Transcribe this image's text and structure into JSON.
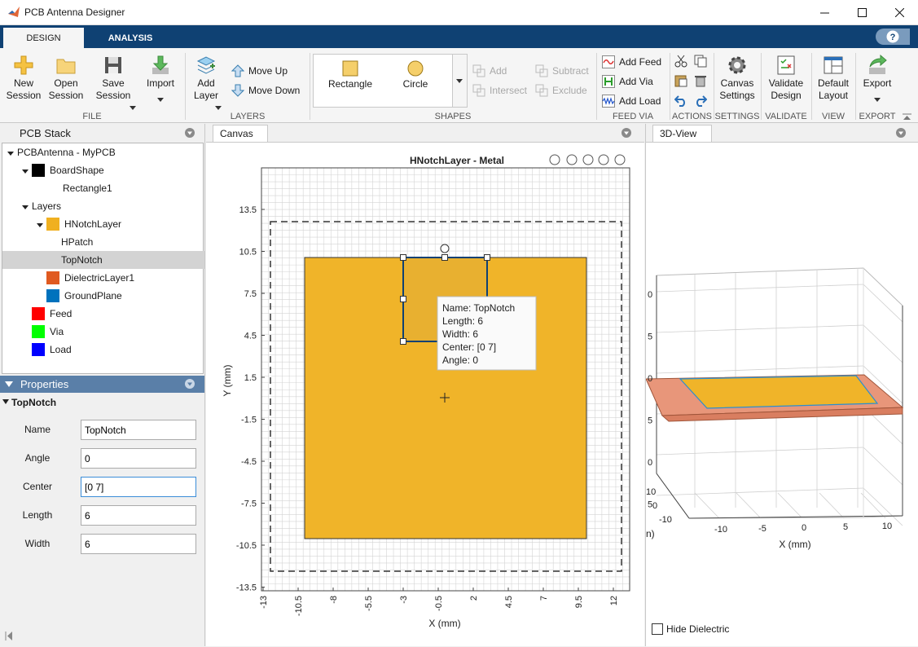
{
  "window": {
    "title": "PCB Antenna Designer"
  },
  "tabs": [
    {
      "label": "DESIGN",
      "active": true
    },
    {
      "label": "ANALYSIS",
      "active": false
    }
  ],
  "toolstrip": {
    "file": {
      "label": "FILE",
      "new_session": "New\nSession",
      "open_session": "Open\nSession",
      "save_session": "Save\nSession",
      "import": "Import"
    },
    "layers": {
      "label": "LAYERS",
      "add_layer": "Add\nLayer",
      "move_up": "Move Up",
      "move_down": "Move Down"
    },
    "shapes": {
      "label": "SHAPES",
      "rectangle": "Rectangle",
      "circle": "Circle",
      "add": "Add",
      "subtract": "Subtract",
      "intersect": "Intersect",
      "exclude": "Exclude"
    },
    "feed_via": {
      "label": "FEED VIA",
      "add_feed": "Add Feed",
      "add_via": "Add Via",
      "add_load": "Add Load"
    },
    "actions": {
      "label": "ACTIONS"
    },
    "settings": {
      "label": "SETTINGS",
      "canvas_settings": "Canvas\nSettings"
    },
    "validate": {
      "label": "VALIDATE",
      "validate_design": "Validate\nDesign"
    },
    "view": {
      "label": "VIEW",
      "default_layout": "Default\nLayout"
    },
    "export": {
      "label": "EXPORT",
      "export": "Export"
    }
  },
  "pcb_stack": {
    "title": "PCB Stack",
    "items": [
      {
        "label": "PCBAntenna - MyPCB",
        "level": 0,
        "expander": true,
        "swatch": null
      },
      {
        "label": "BoardShape",
        "level": 1,
        "expander": true,
        "swatch": "#000000"
      },
      {
        "label": "Rectangle1",
        "level": 2,
        "expander": false,
        "swatch": null
      },
      {
        "label": "Layers",
        "level": 1,
        "expander": true,
        "swatch": null
      },
      {
        "label": "HNotchLayer",
        "level": 2,
        "expander": true,
        "swatch": "#f0b020"
      },
      {
        "label": "HPatch",
        "level": 3,
        "expander": false,
        "swatch": null
      },
      {
        "label": "TopNotch",
        "level": 3,
        "expander": false,
        "swatch": null,
        "selected": true
      },
      {
        "label": "DielectricLayer1",
        "level": 2,
        "expander": false,
        "swatch": "#e05a20"
      },
      {
        "label": "GroundPlane",
        "level": 2,
        "expander": false,
        "swatch": "#0072bd"
      },
      {
        "label": "Feed",
        "level": 1,
        "expander": false,
        "swatch": "#ff0000"
      },
      {
        "label": "Via",
        "level": 1,
        "expander": false,
        "swatch": "#00ff00"
      },
      {
        "label": "Load",
        "level": 1,
        "expander": false,
        "swatch": "#0000ff"
      }
    ]
  },
  "properties": {
    "title": "Properties",
    "object": "TopNotch",
    "fields": [
      {
        "label": "Name",
        "value": "TopNotch"
      },
      {
        "label": "Angle",
        "value": "0"
      },
      {
        "label": "Center",
        "value": "[0 7]",
        "focused": true
      },
      {
        "label": "Length",
        "value": "6"
      },
      {
        "label": "Width",
        "value": "6"
      }
    ]
  },
  "canvas": {
    "tab": "Canvas",
    "plot_title": "HNotchLayer - Metal",
    "xlabel": "X (mm)",
    "ylabel": "Y (mm)",
    "xticks": [
      "-13",
      "-10.5",
      "-8",
      "-5.5",
      "-3",
      "-0.5",
      "2",
      "4.5",
      "7",
      "9.5",
      "12"
    ],
    "yticks": [
      "13.5",
      "10.5",
      "7.5",
      "4.5",
      "1.5",
      "-1.5",
      "-4.5",
      "-7.5",
      "-10.5",
      "-13.5"
    ],
    "tooltip": [
      "Name: TopNotch",
      "Length: 6",
      "Width: 6",
      "Center: [0 7]",
      "Angle: 0"
    ]
  },
  "view3d": {
    "tab": "3D-View",
    "xlabel": "X (mm)",
    "yaxis_partial": "n)",
    "xticks": [
      "-10",
      "-5",
      "0",
      "5",
      "10"
    ],
    "yticks": [
      "10",
      "0",
      "-10"
    ],
    "zticks": [
      "0",
      "5",
      "0",
      "5",
      "0",
      "5"
    ],
    "hide_dielectric": "Hide Dielectric"
  },
  "colors": {
    "accent": "#0f4173",
    "metal": "#f0b429",
    "dielectric": "#e8967a",
    "selection": "#0f4173"
  }
}
